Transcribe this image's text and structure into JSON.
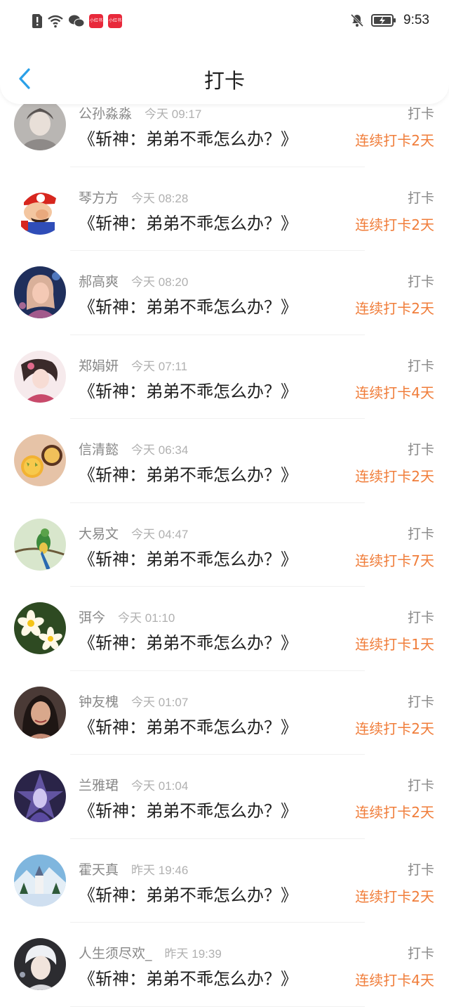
{
  "status_bar": {
    "time": "9:53",
    "app_badges": [
      "小红书",
      "小红书"
    ]
  },
  "header": {
    "title": "打卡"
  },
  "colors": {
    "accent_back": "#2aa0e8",
    "streak": "#f07d3a",
    "muted": "#888888"
  },
  "rows": [
    {
      "name": "公孙淼淼",
      "time": "今天 09:17",
      "book": "《斩神：弟弟不乖怎么办？》",
      "action": "打卡",
      "streak": "连续打卡2天",
      "avatar": "avatar-girl-gray"
    },
    {
      "name": "琴方方",
      "time": "今天 08:28",
      "book": "《斩神：弟弟不乖怎么办？》",
      "action": "打卡",
      "streak": "连续打卡2天",
      "avatar": "avatar-mario"
    },
    {
      "name": "郝高爽",
      "time": "今天 08:20",
      "book": "《斩神：弟弟不乖怎么办？》",
      "action": "打卡",
      "streak": "连续打卡2天",
      "avatar": "avatar-girl-blue"
    },
    {
      "name": "郑娟妍",
      "time": "今天 07:11",
      "book": "《斩神：弟弟不乖怎么办？》",
      "action": "打卡",
      "streak": "连续打卡4天",
      "avatar": "avatar-girl-pink"
    },
    {
      "name": "信清懿",
      "time": "今天 06:34",
      "book": "《斩神：弟弟不乖怎么办？》",
      "action": "打卡",
      "streak": "连续打卡2天",
      "avatar": "avatar-cupcakes"
    },
    {
      "name": "大易文",
      "time": "今天 04:47",
      "book": "《斩神：弟弟不乖怎么办？》",
      "action": "打卡",
      "streak": "连续打卡7天",
      "avatar": "avatar-bird"
    },
    {
      "name": "弭今",
      "time": "今天 01:10",
      "book": "《斩神：弟弟不乖怎么办？》",
      "action": "打卡",
      "streak": "连续打卡1天",
      "avatar": "avatar-flowers"
    },
    {
      "name": "钟友槐",
      "time": "今天 01:07",
      "book": "《斩神：弟弟不乖怎么办？》",
      "action": "打卡",
      "streak": "连续打卡2天",
      "avatar": "avatar-woman"
    },
    {
      "name": "兰雅珺",
      "time": "今天 01:04",
      "book": "《斩神：弟弟不乖怎么办？》",
      "action": "打卡",
      "streak": "连续打卡2天",
      "avatar": "avatar-fantasy"
    },
    {
      "name": "霍天真",
      "time": "昨天 19:46",
      "book": "《斩神：弟弟不乖怎么办？》",
      "action": "打卡",
      "streak": "连续打卡2天",
      "avatar": "avatar-winter-church"
    },
    {
      "name": "人生须尽欢_",
      "time": "昨天 19:39",
      "book": "《斩神：弟弟不乖怎么办？》",
      "action": "打卡",
      "streak": "连续打卡4天",
      "avatar": "avatar-boy-white-hair"
    }
  ]
}
